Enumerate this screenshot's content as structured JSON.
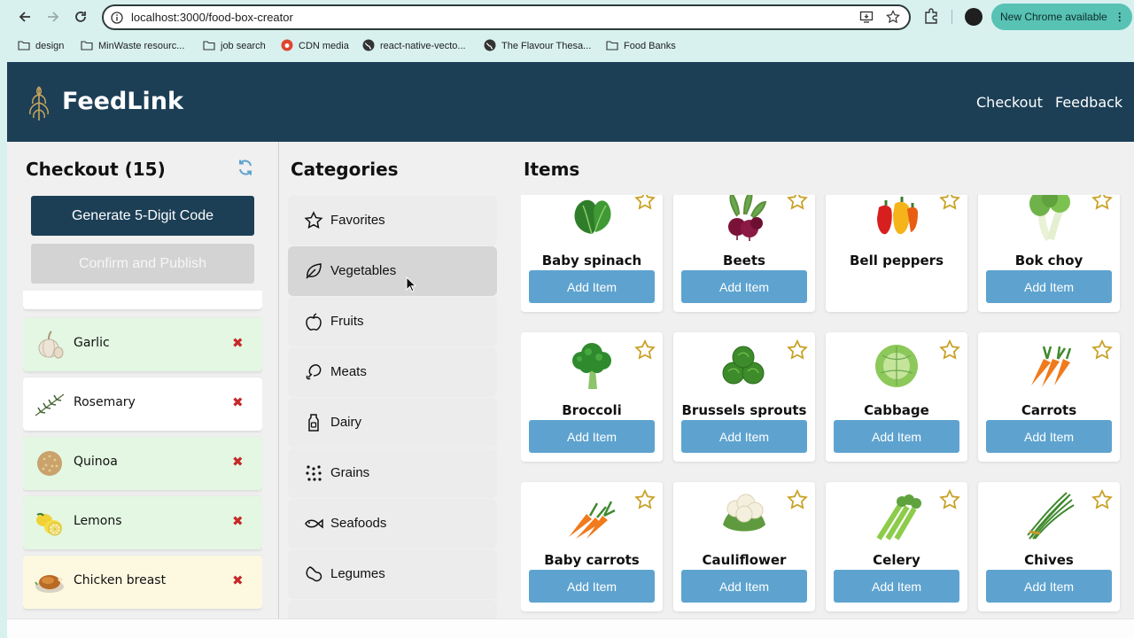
{
  "browser": {
    "url": "localhost:3000/food-box-creator",
    "update_label": "New Chrome available",
    "bookmarks": [
      {
        "label": "design",
        "icon": "folder-icon"
      },
      {
        "label": "MinWaste resourc...",
        "icon": "folder-icon"
      },
      {
        "label": "job search",
        "icon": "folder-icon"
      },
      {
        "label": "CDN media",
        "icon": "site-icon"
      },
      {
        "label": "react-native-vecto...",
        "icon": "globe-icon"
      },
      {
        "label": "The Flavour Thesa...",
        "icon": "globe-icon"
      },
      {
        "label": "Food Banks",
        "icon": "folder-icon"
      }
    ]
  },
  "header": {
    "brand": "FeedLink",
    "nav": [
      "Checkout",
      "Feedback"
    ]
  },
  "checkout": {
    "title": "Checkout (15)",
    "generate_label": "Generate 5-Digit Code",
    "confirm_label": "Confirm and Publish",
    "items": [
      {
        "name": "Garlic",
        "status": "green",
        "icon": "garlic"
      },
      {
        "name": "Rosemary",
        "status": "white",
        "icon": "rosemary"
      },
      {
        "name": "Quinoa",
        "status": "green",
        "icon": "quinoa"
      },
      {
        "name": "Lemons",
        "status": "green",
        "icon": "lemons"
      },
      {
        "name": "Chicken breast",
        "status": "yellow",
        "icon": "chicken"
      }
    ]
  },
  "categories": {
    "title": "Categories",
    "selected": "Vegetables",
    "items": [
      {
        "label": "Favorites",
        "icon": "star-icon"
      },
      {
        "label": "Vegetables",
        "icon": "leaf-icon"
      },
      {
        "label": "Fruits",
        "icon": "apple-icon"
      },
      {
        "label": "Meats",
        "icon": "drumstick-icon"
      },
      {
        "label": "Dairy",
        "icon": "milk-icon"
      },
      {
        "label": "Grains",
        "icon": "grains-icon"
      },
      {
        "label": "Seafoods",
        "icon": "fish-icon"
      },
      {
        "label": "Legumes",
        "icon": "legume-icon"
      }
    ]
  },
  "items": {
    "title": "Items",
    "add_label": "Add Item",
    "cards": [
      {
        "name": "Baby spinach",
        "icon": "spinach",
        "has_add": true
      },
      {
        "name": "Beets",
        "icon": "beets",
        "has_add": true
      },
      {
        "name": "Bell peppers",
        "icon": "peppers",
        "has_add": false
      },
      {
        "name": "Bok choy",
        "icon": "bokchoy",
        "has_add": true
      },
      {
        "name": "Broccoli",
        "icon": "broccoli",
        "has_add": true
      },
      {
        "name": "Brussels sprouts",
        "icon": "brussels",
        "has_add": true
      },
      {
        "name": "Cabbage",
        "icon": "cabbage",
        "has_add": true
      },
      {
        "name": "Carrots",
        "icon": "carrots",
        "has_add": true
      },
      {
        "name": "Baby carrots",
        "icon": "babycarrots",
        "has_add": true
      },
      {
        "name": "Cauliflower",
        "icon": "cauliflower",
        "has_add": true
      },
      {
        "name": "Celery",
        "icon": "celery",
        "has_add": true
      },
      {
        "name": "Chives",
        "icon": "chives",
        "has_add": true
      }
    ]
  },
  "colors": {
    "header": "#1c3f56",
    "add_button": "#5ea3cf",
    "remove_x": "#c62828",
    "star": "#c9a227",
    "checkout_green": "#e3f7e3",
    "checkout_yellow": "#fdf9e1"
  }
}
